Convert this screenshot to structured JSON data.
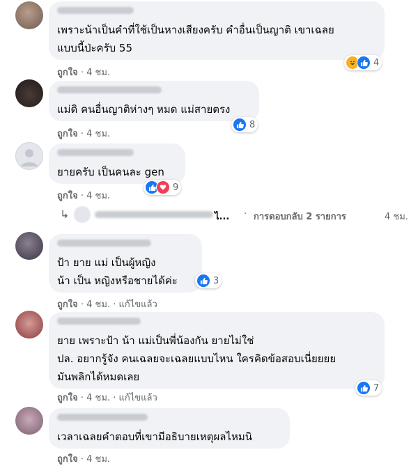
{
  "comments": [
    {
      "text_lines": [
        "เพราะน้าเป็นคำที่ใช้เป็นหางเสียงครับ คำอื่นเป็นญาติ เขาเฉลย",
        "แบบนี้ป่ะครับ 55"
      ],
      "like_label": "ถูกใจ",
      "time": "4 ชม.",
      "edited": "",
      "reactions": [
        "haha-icon",
        "like-icon"
      ],
      "reaction_count": "4"
    },
    {
      "text_lines": [
        "แม่ดิ คนอื่นญาติห่างๆ หมด แม่สายตรง"
      ],
      "like_label": "ถูกใจ",
      "time": "4 ชม.",
      "edited": "",
      "reactions": [
        "like-icon"
      ],
      "reaction_count": "8"
    },
    {
      "text_lines": [
        "ยายครับ เป็นคนละ gen"
      ],
      "like_label": "ถูกใจ",
      "time": "4 ชม.",
      "edited": "",
      "reactions": [
        "like-icon",
        "love-icon"
      ],
      "reaction_count": "9"
    },
    {
      "text_lines": [
        "ป้า ยาย แม่ เป็นผู้หญิง",
        "น้า เป็น หญิงหรือชายได้ค่ะ"
      ],
      "like_label": "ถูกใจ",
      "time": "4 ชม.",
      "edited": "แก้ไขแล้ว",
      "reactions": [
        "like-icon"
      ],
      "reaction_count": "3"
    },
    {
      "text_lines": [
        "ยาย เพราะป้า น้า แม่เป็นพี่น้องกัน ยายไม่ใช่",
        "ปล. อยากรู้จัง คนเฉลยจะเฉลยแบบไหน ใครคิดข้อสอบเนี่ยยยย",
        "มันพลิกได้หมดเลย"
      ],
      "like_label": "ถูกใจ",
      "time": "4 ชม.",
      "edited": "แก้ไขแล้ว",
      "reactions": [
        "like-icon"
      ],
      "reaction_count": "7"
    },
    {
      "text_lines": [
        "เวลาเฉลยคำตอบที่เขามีอธิบายเหตุผลไหมนิ"
      ],
      "like_label": "ถูกใจ",
      "time": "4 ชม.",
      "edited": "",
      "reactions": [],
      "reaction_count": ""
    }
  ],
  "reply_thread": {
    "arrow": "↳",
    "ellipsis": "ไ...",
    "dot": "·",
    "replies_label": "การตอบกลับ 2 รายการ",
    "time": "4 ชม."
  },
  "separator": "·",
  "colors": {
    "like": "#1877f2",
    "love": "#f33e58",
    "haha": "#f7b125",
    "bubble": "#f0f2f5",
    "meta": "#65676b"
  }
}
